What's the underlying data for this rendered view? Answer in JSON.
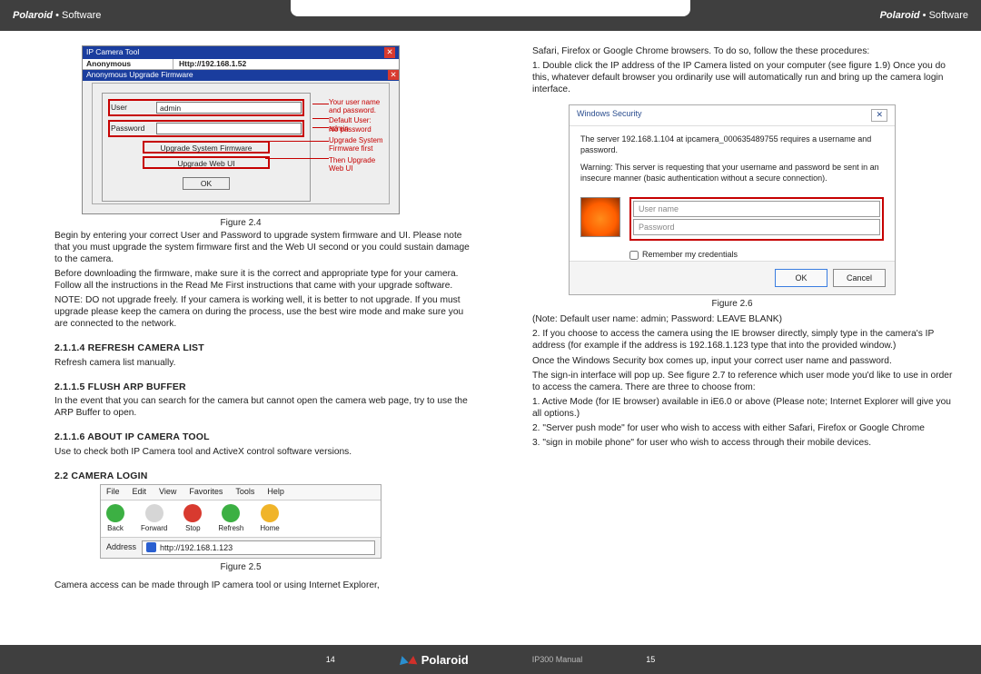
{
  "header": {
    "brand": "Polaroid",
    "section": "Software"
  },
  "left": {
    "fig24": {
      "title": "IP Camera Tool",
      "col1": "Anonymous",
      "col2": "Http://192.168.1.52",
      "subtitle": "Anonymous Upgrade Firmware",
      "user_label": "User",
      "user_value": "admin",
      "pw_label": "Password",
      "btn_sys": "Upgrade System Firmware",
      "btn_web": "Upgrade Web UI",
      "btn_ok": "OK",
      "annot1a": "Your user name",
      "annot1b": "and password.",
      "annot2": "Default User: admin",
      "annot3": "No password",
      "annot4a": "Upgrade System",
      "annot4b": "Firmware first",
      "annot5": "Then Upgrade Web UI",
      "caption": "Figure 2.4"
    },
    "p1": "Begin by entering your correct User and Password to upgrade system firmware and UI. Please note that you must upgrade the system firmware first and the Web UI second or you could sustain damage to the camera.",
    "p2": "Before downloading the firmware, make sure it is the correct and appropriate type for your camera. Follow all the instructions in the Read Me First instructions that came with your upgrade software.",
    "p3": "NOTE: DO not upgrade freely. If your camera is working well, it is better to not upgrade. If you must upgrade please keep the camera on during the process, use the best wire mode and make sure you are connected to the network.",
    "h1": "2.1.1.4 REFRESH CAMERA LIST",
    "p4": "Refresh camera list manually.",
    "h2": "2.1.1.5 FLUSH ARP BUFFER",
    "p5": "In the event that you can search for the camera but cannot open the camera web page, try to use the ARP Buffer to open.",
    "h3": "2.1.1.6 ABOUT IP CAMERA TOOL",
    "p6": "Use to check both IP Camera tool and ActiveX control software versions.",
    "h4": "2.2 CAMERA LOGIN",
    "fig25": {
      "menu": [
        "File",
        "Edit",
        "View",
        "Favorites",
        "Tools",
        "Help"
      ],
      "icons": [
        {
          "label": "Back",
          "color": "#3cb043"
        },
        {
          "label": "Forward",
          "color": "#d6d6d6"
        },
        {
          "label": "Stop",
          "color": "#d83a2f"
        },
        {
          "label": "Refresh",
          "color": "#3cb043"
        },
        {
          "label": "Home",
          "color": "#f0b429"
        }
      ],
      "addr_label": "Address",
      "addr_value": "http://192.168.1.123",
      "caption": "Figure 2.5"
    },
    "p7": "Camera access can be made through IP camera tool or using Internet Explorer,"
  },
  "right": {
    "p1": "Safari, Firefox or Google Chrome browsers. To do so, follow the these procedures:",
    "p2": "1. Double click the IP address of the IP Camera listed on your computer (see figure 1.9) Once you do this, whatever default browser you ordinarily use will automatically run and bring up the camera login interface.",
    "fig26": {
      "title": "Windows Security",
      "msg1": "The server 192.168.1.104 at ipcamera_000635489755 requires a username and password.",
      "msg2": "Warning: This server is requesting that your username and password be sent in an insecure manner (basic authentication without a secure connection).",
      "user_ph": "User name",
      "pw_ph": "Password",
      "remember": "Remember my credentials",
      "ok": "OK",
      "cancel": "Cancel",
      "caption": "Figure 2.6"
    },
    "p3": "(Note: Default user name: admin; Password: LEAVE BLANK)",
    "p4": "2. If you choose to access the camera using the IE browser directly, simply type in the camera's IP address (for example if the address is 192.168.1.123 type that into the provided window.)",
    "p5": "Once the Windows Security box comes up, input your correct user name and password.",
    "p6": "The sign-in interface will pop up. See figure 2.7 to reference which user mode you'd like to use in order to access the camera. There are three to choose from:",
    "p7": "1. Active Mode (for IE browser) available in iE6.0 or above (Please note; Internet Explorer will give you all options.)",
    "p8": "2. \"Server push mode\" for user who wish to access with either Safari, Firefox or Google Chrome",
    "p9": "3. \"sign in mobile phone\" for user who wish to access through their mobile devices."
  },
  "footer": {
    "page_left": "14",
    "brand": "Polaroid",
    "manual": "IP300 Manual",
    "page_right": "15"
  }
}
